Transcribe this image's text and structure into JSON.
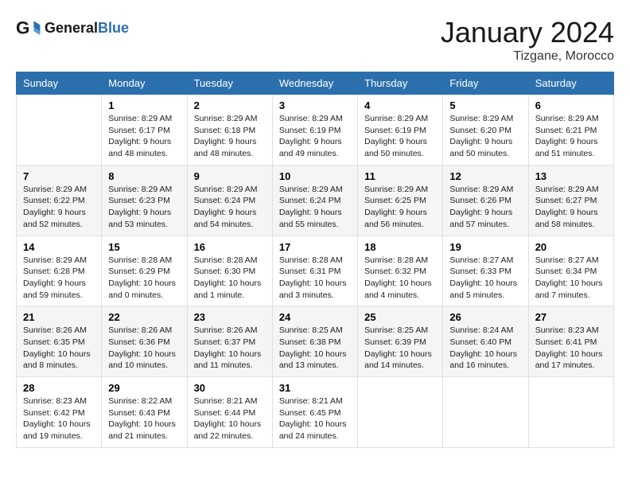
{
  "header": {
    "logo_general": "General",
    "logo_blue": "Blue",
    "month_title": "January 2024",
    "subtitle": "Tizgane, Morocco"
  },
  "days_of_week": [
    "Sunday",
    "Monday",
    "Tuesday",
    "Wednesday",
    "Thursday",
    "Friday",
    "Saturday"
  ],
  "weeks": [
    [
      {
        "day": "",
        "sunrise": "",
        "sunset": "",
        "daylight": ""
      },
      {
        "day": "1",
        "sunrise": "Sunrise: 8:29 AM",
        "sunset": "Sunset: 6:17 PM",
        "daylight": "Daylight: 9 hours and 48 minutes."
      },
      {
        "day": "2",
        "sunrise": "Sunrise: 8:29 AM",
        "sunset": "Sunset: 6:18 PM",
        "daylight": "Daylight: 9 hours and 48 minutes."
      },
      {
        "day": "3",
        "sunrise": "Sunrise: 8:29 AM",
        "sunset": "Sunset: 6:19 PM",
        "daylight": "Daylight: 9 hours and 49 minutes."
      },
      {
        "day": "4",
        "sunrise": "Sunrise: 8:29 AM",
        "sunset": "Sunset: 6:19 PM",
        "daylight": "Daylight: 9 hours and 50 minutes."
      },
      {
        "day": "5",
        "sunrise": "Sunrise: 8:29 AM",
        "sunset": "Sunset: 6:20 PM",
        "daylight": "Daylight: 9 hours and 50 minutes."
      },
      {
        "day": "6",
        "sunrise": "Sunrise: 8:29 AM",
        "sunset": "Sunset: 6:21 PM",
        "daylight": "Daylight: 9 hours and 51 minutes."
      }
    ],
    [
      {
        "day": "7",
        "sunrise": "Sunrise: 8:29 AM",
        "sunset": "Sunset: 6:22 PM",
        "daylight": "Daylight: 9 hours and 52 minutes."
      },
      {
        "day": "8",
        "sunrise": "Sunrise: 8:29 AM",
        "sunset": "Sunset: 6:23 PM",
        "daylight": "Daylight: 9 hours and 53 minutes."
      },
      {
        "day": "9",
        "sunrise": "Sunrise: 8:29 AM",
        "sunset": "Sunset: 6:24 PM",
        "daylight": "Daylight: 9 hours and 54 minutes."
      },
      {
        "day": "10",
        "sunrise": "Sunrise: 8:29 AM",
        "sunset": "Sunset: 6:24 PM",
        "daylight": "Daylight: 9 hours and 55 minutes."
      },
      {
        "day": "11",
        "sunrise": "Sunrise: 8:29 AM",
        "sunset": "Sunset: 6:25 PM",
        "daylight": "Daylight: 9 hours and 56 minutes."
      },
      {
        "day": "12",
        "sunrise": "Sunrise: 8:29 AM",
        "sunset": "Sunset: 6:26 PM",
        "daylight": "Daylight: 9 hours and 57 minutes."
      },
      {
        "day": "13",
        "sunrise": "Sunrise: 8:29 AM",
        "sunset": "Sunset: 6:27 PM",
        "daylight": "Daylight: 9 hours and 58 minutes."
      }
    ],
    [
      {
        "day": "14",
        "sunrise": "Sunrise: 8:29 AM",
        "sunset": "Sunset: 6:28 PM",
        "daylight": "Daylight: 9 hours and 59 minutes."
      },
      {
        "day": "15",
        "sunrise": "Sunrise: 8:28 AM",
        "sunset": "Sunset: 6:29 PM",
        "daylight": "Daylight: 10 hours and 0 minutes."
      },
      {
        "day": "16",
        "sunrise": "Sunrise: 8:28 AM",
        "sunset": "Sunset: 6:30 PM",
        "daylight": "Daylight: 10 hours and 1 minute."
      },
      {
        "day": "17",
        "sunrise": "Sunrise: 8:28 AM",
        "sunset": "Sunset: 6:31 PM",
        "daylight": "Daylight: 10 hours and 3 minutes."
      },
      {
        "day": "18",
        "sunrise": "Sunrise: 8:28 AM",
        "sunset": "Sunset: 6:32 PM",
        "daylight": "Daylight: 10 hours and 4 minutes."
      },
      {
        "day": "19",
        "sunrise": "Sunrise: 8:27 AM",
        "sunset": "Sunset: 6:33 PM",
        "daylight": "Daylight: 10 hours and 5 minutes."
      },
      {
        "day": "20",
        "sunrise": "Sunrise: 8:27 AM",
        "sunset": "Sunset: 6:34 PM",
        "daylight": "Daylight: 10 hours and 7 minutes."
      }
    ],
    [
      {
        "day": "21",
        "sunrise": "Sunrise: 8:26 AM",
        "sunset": "Sunset: 6:35 PM",
        "daylight": "Daylight: 10 hours and 8 minutes."
      },
      {
        "day": "22",
        "sunrise": "Sunrise: 8:26 AM",
        "sunset": "Sunset: 6:36 PM",
        "daylight": "Daylight: 10 hours and 10 minutes."
      },
      {
        "day": "23",
        "sunrise": "Sunrise: 8:26 AM",
        "sunset": "Sunset: 6:37 PM",
        "daylight": "Daylight: 10 hours and 11 minutes."
      },
      {
        "day": "24",
        "sunrise": "Sunrise: 8:25 AM",
        "sunset": "Sunset: 6:38 PM",
        "daylight": "Daylight: 10 hours and 13 minutes."
      },
      {
        "day": "25",
        "sunrise": "Sunrise: 8:25 AM",
        "sunset": "Sunset: 6:39 PM",
        "daylight": "Daylight: 10 hours and 14 minutes."
      },
      {
        "day": "26",
        "sunrise": "Sunrise: 8:24 AM",
        "sunset": "Sunset: 6:40 PM",
        "daylight": "Daylight: 10 hours and 16 minutes."
      },
      {
        "day": "27",
        "sunrise": "Sunrise: 8:23 AM",
        "sunset": "Sunset: 6:41 PM",
        "daylight": "Daylight: 10 hours and 17 minutes."
      }
    ],
    [
      {
        "day": "28",
        "sunrise": "Sunrise: 8:23 AM",
        "sunset": "Sunset: 6:42 PM",
        "daylight": "Daylight: 10 hours and 19 minutes."
      },
      {
        "day": "29",
        "sunrise": "Sunrise: 8:22 AM",
        "sunset": "Sunset: 6:43 PM",
        "daylight": "Daylight: 10 hours and 21 minutes."
      },
      {
        "day": "30",
        "sunrise": "Sunrise: 8:21 AM",
        "sunset": "Sunset: 6:44 PM",
        "daylight": "Daylight: 10 hours and 22 minutes."
      },
      {
        "day": "31",
        "sunrise": "Sunrise: 8:21 AM",
        "sunset": "Sunset: 6:45 PM",
        "daylight": "Daylight: 10 hours and 24 minutes."
      },
      {
        "day": "",
        "sunrise": "",
        "sunset": "",
        "daylight": ""
      },
      {
        "day": "",
        "sunrise": "",
        "sunset": "",
        "daylight": ""
      },
      {
        "day": "",
        "sunrise": "",
        "sunset": "",
        "daylight": ""
      }
    ]
  ]
}
